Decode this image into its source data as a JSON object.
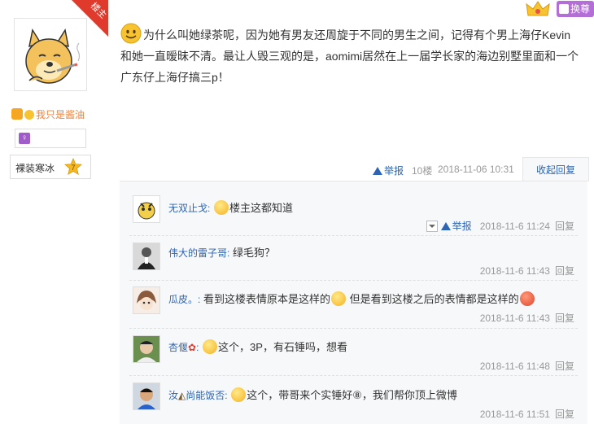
{
  "author": {
    "signature": "我只是酱油",
    "tag_label": "裸装寒冰",
    "level": "7",
    "badge_label": "楼主"
  },
  "top_right": {
    "swap_label": "换尊"
  },
  "post": {
    "line1": "为什么叫她绿茶呢，因为她有男友还周旋于不同的男生之间，记得有个男上海仔Kevin",
    "line2": "和她一直暧昧不清。最让人毁三观的是，aomimi居然在上一届学长家的海边别墅里面和一个",
    "line3": "广东仔上海仔搞三p！",
    "report_label": "举报",
    "floor": "10楼",
    "time": "2018-11-06 10:31",
    "collapse_label": "收起回复"
  },
  "comments": [
    {
      "user": "无双止戈:",
      "text": "楼主这都知道",
      "time": "2018-11-6 11:24",
      "reply_label": "回复",
      "report_label": "举报"
    },
    {
      "user": "伟大的雷子哥:",
      "text": "绿毛狗？",
      "time": "2018-11-6 11:43",
      "reply_label": "回复"
    },
    {
      "user": "瓜皮。:",
      "text_a": "看到这楼表情原本是这样的",
      "text_b": "但是看到这楼之后的表情都是这样的",
      "time": "2018-11-6 11:43",
      "reply_label": "回复"
    },
    {
      "user": "杏偃",
      "user_suffix": ":",
      "text": "这个，3P，有石锤吗，想看",
      "time": "2018-11-6 11:48",
      "reply_label": "回复"
    },
    {
      "user": "汝",
      "user_suffix": "尚能饭否:",
      "text_a": "这个，带哥来个实锤好⑧，我们帮你顶上微博",
      "time": "2018-11-6 11:51",
      "reply_label": "回复"
    }
  ]
}
